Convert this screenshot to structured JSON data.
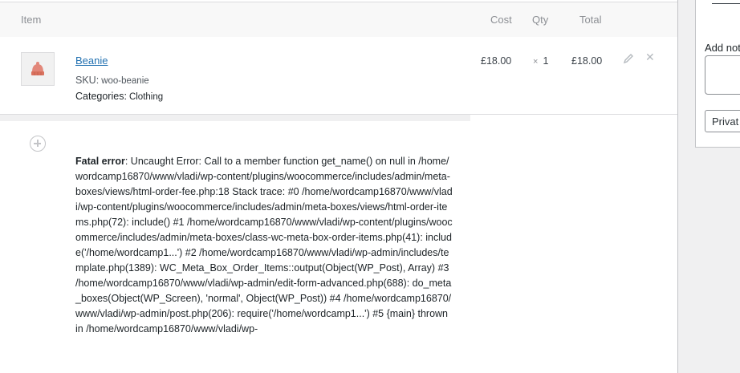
{
  "items_header": {
    "item": "Item",
    "cost": "Cost",
    "qty": "Qty",
    "total": "Total"
  },
  "line_item": {
    "name": "Beanie",
    "sku_label": "SKU:",
    "sku_value": "woo-beanie",
    "categories_label": "Categories:",
    "categories_value": "Clothing",
    "cost": "£18.00",
    "qty_prefix": "×",
    "qty": "1",
    "total": "£18.00",
    "thumbnail_icon": "beanie-thumbnail-icon",
    "edit_icon": "pencil-icon",
    "delete_icon": "close-icon"
  },
  "error": {
    "label": "Fatal error",
    "message": ": Uncaught Error: Call to a member function get_name() on null in /home/wordcamp16870/www/vladi/wp-content/plugins/woocommerce/includes/admin/meta-boxes/views/html-order-fee.php:18 Stack trace: #0 /home/wordcamp16870/www/vladi/wp-content/plugins/woocommerce/includes/admin/meta-boxes/views/html-order-items.php(72): include() #1 /home/wordcamp16870/www/vladi/wp-content/plugins/woocommerce/includes/admin/meta-boxes/class-wc-meta-box-order-items.php(41): include('/home/wordcamp1...') #2 /home/wordcamp16870/www/vladi/wp-admin/includes/template.php(1389): WC_Meta_Box_Order_Items::output(Object(WP_Post), Array) #3 /home/wordcamp16870/www/vladi/wp-admin/edit-form-advanced.php(688): do_meta_boxes(Object(WP_Screen), 'normal', Object(WP_Post)) #4 /home/wordcamp16870/www/vladi/wp-admin/post.php(206): require('/home/wordcamp1...') #5 {main} thrown in /home/wordcamp16870/www/vladi/wp-"
  },
  "sidebar": {
    "add_note_label": "Add not",
    "note_type_value": "Privat"
  },
  "colors": {
    "link": "#2271b1",
    "header_bg": "#f8f8f8",
    "border": "#dcdcde"
  }
}
